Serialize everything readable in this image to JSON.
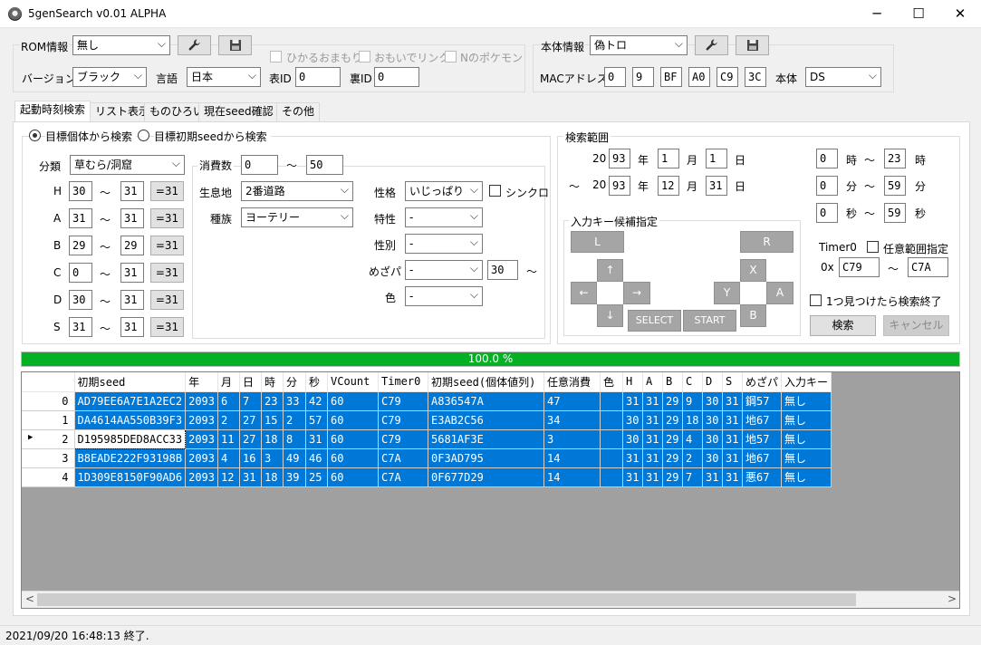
{
  "window": {
    "title": "5genSearch v0.01 ALPHA",
    "minimize": "─",
    "maximize": "☐",
    "close": "✕"
  },
  "rom": {
    "label": "ROM情報",
    "value": "無し",
    "settings_icon": "wrench-icon",
    "save_icon": "save-icon",
    "version_label": "バージョン",
    "version": "ブラック",
    "lang_label": "言語",
    "lang": "日本",
    "front_id_label": "表ID",
    "front_id": "0",
    "back_id_label": "裏ID",
    "back_id": "0",
    "memory_label": "ひかるおまもり",
    "link_label": "おもいでリンク",
    "npoke_label": "Nのポケモン"
  },
  "device": {
    "label": "本体情報",
    "value": "偽トロ",
    "mac_label": "MACアドレス",
    "mac": [
      "0",
      "9",
      "BF",
      "A0",
      "C9",
      "3C"
    ],
    "hw_label": "本体",
    "hw": "DS"
  },
  "tabs": [
    "起動時刻検索",
    "リスト表示",
    "ものひろい",
    "現在seed確認",
    "その他"
  ],
  "mode": {
    "a": "目標個体から検索",
    "b": "目標初期seedから検索"
  },
  "left": {
    "cat_label": "分類",
    "cat": "草むら/洞窟",
    "stats": [
      {
        "k": "H",
        "min": "30",
        "max": "31"
      },
      {
        "k": "A",
        "min": "31",
        "max": "31"
      },
      {
        "k": "B",
        "min": "29",
        "max": "29"
      },
      {
        "k": "C",
        "min": "0",
        "max": "31"
      },
      {
        "k": "D",
        "min": "30",
        "max": "31"
      },
      {
        "k": "S",
        "min": "31",
        "max": "31"
      }
    ],
    "eq31": "=31",
    "tilde": "～",
    "cons_label": "消費数",
    "cons_min": "0",
    "cons_max": "50",
    "habitat_label": "生息地",
    "habitat": "2番道路",
    "species_label": "種族",
    "species": "ヨーテリー",
    "nature_label": "性格",
    "nature": "いじっぱり",
    "synchro_label": "シンクロ",
    "ability_label": "特性",
    "ability": "-",
    "gender_label": "性別",
    "gender": "-",
    "hp_label": "めざパ",
    "hp": "-",
    "hp_power": "30",
    "color_label": "色",
    "color": "-"
  },
  "range": {
    "label": "検索範囲",
    "y_prefix": "20",
    "y1": "93",
    "y_label": "年",
    "m1": "1",
    "m_label": "月",
    "d1": "1",
    "d_label": "日",
    "y2": "93",
    "m2": "12",
    "d2": "31",
    "h1": "0",
    "h2": "23",
    "h_label": "時",
    "mi1": "0",
    "mi2": "59",
    "mi_label": "分",
    "s1": "0",
    "s2": "59",
    "s_label": "秒",
    "tilde": "～"
  },
  "keys": {
    "label": "入力キー候補指定",
    "L": "L",
    "R": "R",
    "up": "↑",
    "down": "↓",
    "left": "←",
    "right": "→",
    "X": "X",
    "Y": "Y",
    "A": "A",
    "B": "B",
    "select": "SELECT",
    "start": "START"
  },
  "timer0": {
    "label": "Timer0",
    "any_label": "任意範囲指定",
    "prefix": "0x",
    "min": "C79",
    "max": "C7A"
  },
  "stop_label": "1つ見つけたら検索終了",
  "search_btn": "検索",
  "cancel_btn": "キャンセル",
  "progress": {
    "text": "100.0 %",
    "value": 1.0
  },
  "table": {
    "headers": [
      "初期seed",
      "年",
      "月",
      "日",
      "時",
      "分",
      "秒",
      "VCount",
      "Timer0",
      "初期seed(個体値列)",
      "任意消費",
      "色",
      "H",
      "A",
      "B",
      "C",
      "D",
      "S",
      "めざパ",
      "入力キー"
    ],
    "rows": [
      {
        "idx": "0",
        "cells": [
          "AD79EE6A7E1A2EC2",
          "2093",
          "6",
          "7",
          "23",
          "33",
          "42",
          "60",
          "C79",
          "A836547A",
          "47",
          "",
          "31",
          "31",
          "29",
          "9",
          "30",
          "31",
          "鋼57",
          "無し"
        ]
      },
      {
        "idx": "1",
        "cells": [
          "DA4614AA550B39F3",
          "2093",
          "2",
          "27",
          "15",
          "2",
          "57",
          "60",
          "C79",
          "E3AB2C56",
          "34",
          "",
          "30",
          "31",
          "29",
          "18",
          "30",
          "31",
          "地67",
          "無し"
        ]
      },
      {
        "idx": "2",
        "marker": "▶",
        "cells": [
          "D195985DED8ACC33",
          "2093",
          "11",
          "27",
          "18",
          "8",
          "31",
          "60",
          "C79",
          "5681AF3E",
          "3",
          "",
          "30",
          "31",
          "29",
          "4",
          "30",
          "31",
          "地57",
          "無し"
        ]
      },
      {
        "idx": "3",
        "cells": [
          "B8EADE222F93198B",
          "2093",
          "4",
          "16",
          "3",
          "49",
          "46",
          "60",
          "C7A",
          "0F3AD795",
          "14",
          "",
          "31",
          "31",
          "29",
          "2",
          "30",
          "31",
          "地67",
          "無し"
        ]
      },
      {
        "idx": "4",
        "cells": [
          "1D309E8150F90AD6",
          "2093",
          "12",
          "31",
          "18",
          "39",
          "25",
          "60",
          "C7A",
          "0F677D29",
          "14",
          "",
          "31",
          "31",
          "29",
          "7",
          "31",
          "31",
          "悪67",
          "無し"
        ]
      }
    ]
  },
  "scroll": {
    "left": "<",
    "right": ">"
  },
  "status": "2021/09/20 16:48:13 終了."
}
